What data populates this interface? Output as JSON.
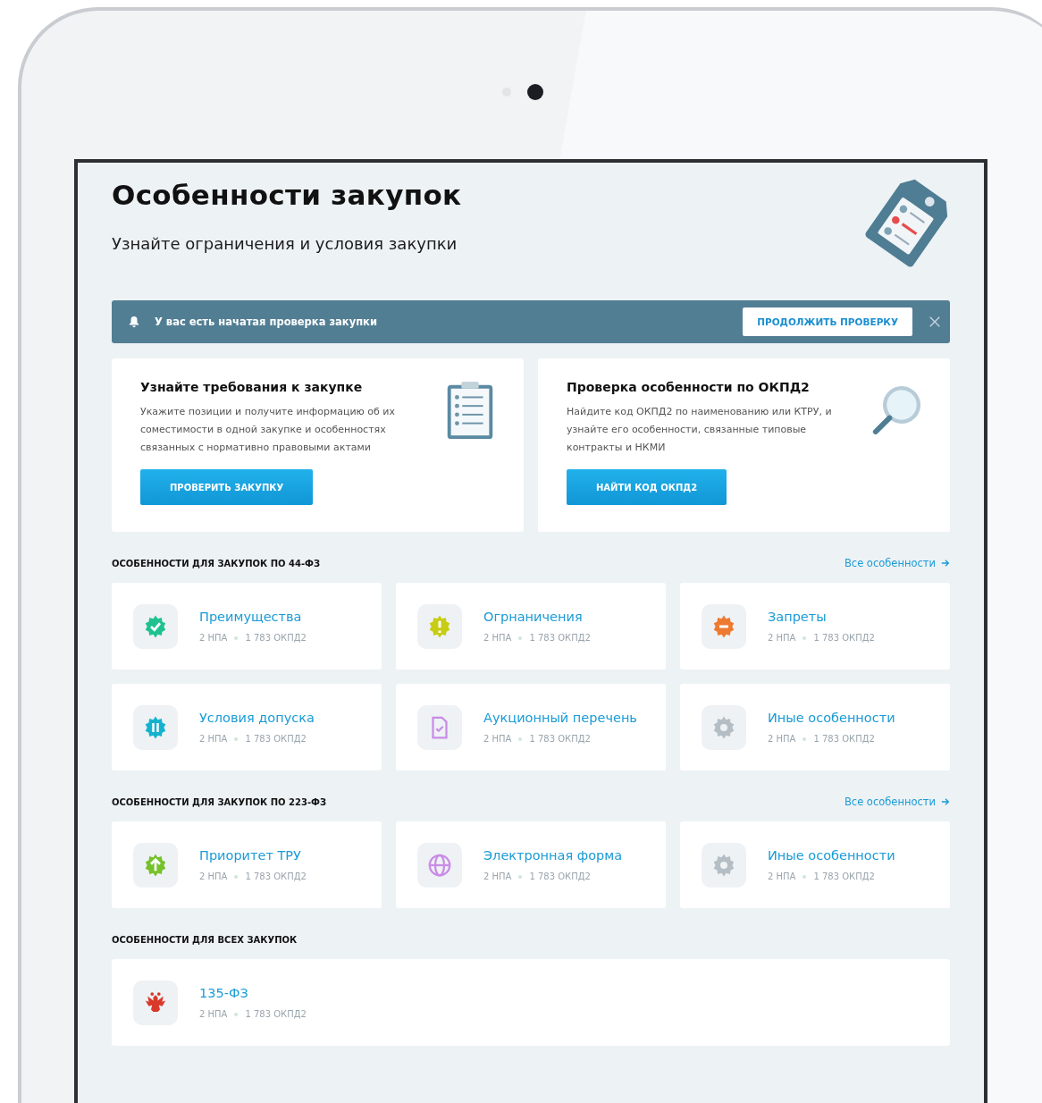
{
  "header": {
    "title": "Особенности закупок",
    "subtitle": "Узнайте ограничения и условия закупки"
  },
  "notice": {
    "text": "У вас есть начатая проверка закупки",
    "button": "ПРОДОЛЖИТЬ ПРОВЕРКУ"
  },
  "promo_cards": [
    {
      "kind": "clipboard",
      "title": "Узнайте требования к закупке",
      "text": "Укажите позиции и получите информацию об их соместимости в одной закупке и особенностях связанных с нормативно правовыми актами",
      "button": "ПРОВЕРИТЬ ЗАКУПКУ"
    },
    {
      "kind": "magnifier",
      "title": "Проверка особенности по ОКПД2",
      "text": "Найдите код ОКПД2 по наименованию или КТРУ, и узнайте его особенности, связанные типовые контракты и НКМИ",
      "button": "НАЙТИ КОД ОКПД2"
    }
  ],
  "sections": [
    {
      "title": "ОСОБЕННОСТИ ДЛЯ ЗАКУПОК ПО 44-ФЗ",
      "link": "Все особенности",
      "items": [
        {
          "kind": "check",
          "color": "#1fc28e",
          "title": "Преимущества",
          "npa": "2 НПА",
          "okpd": "1 783 ОКПД2"
        },
        {
          "kind": "exclaim",
          "color": "#c8cc12",
          "title": "Огрнаничения",
          "npa": "2 НПА",
          "okpd": "1 783 ОКПД2"
        },
        {
          "kind": "minus",
          "color": "#ee7a32",
          "title": "Запреты",
          "npa": "2 НПА",
          "okpd": "1 783 ОКПД2"
        },
        {
          "kind": "pause",
          "color": "#13b3cf",
          "title": "Условия допуска",
          "npa": "2 НПА",
          "okpd": "1 783 ОКПД2"
        },
        {
          "kind": "document",
          "color": "#c98ce6",
          "title": "Аукционный перечень",
          "npa": "2 НПА",
          "okpd": "1 783 ОКПД2"
        },
        {
          "kind": "gear",
          "color": "#b5bec5",
          "title": "Иные особенности",
          "npa": "2 НПА",
          "okpd": "1 783 ОКПД2"
        }
      ]
    },
    {
      "title": "ОСОБЕННОСТИ ДЛЯ ЗАКУПОК ПО 223-ФЗ",
      "link": "Все особенности",
      "items": [
        {
          "kind": "up",
          "color": "#75c22b",
          "title": "Приоритет ТРУ",
          "npa": "2 НПА",
          "okpd": "1 783 ОКПД2"
        },
        {
          "kind": "globe",
          "color": "#c98ce6",
          "title": "Электронная форма",
          "npa": "2 НПА",
          "okpd": "1 783 ОКПД2"
        },
        {
          "kind": "gear",
          "color": "#b5bec5",
          "title": "Иные особенности",
          "npa": "2 НПА",
          "okpd": "1 783 ОКПД2"
        }
      ]
    },
    {
      "title": "ОСОБЕННОСТИ ДЛЯ ВСЕХ ЗАКУПОК",
      "items": [
        {
          "kind": "eagle",
          "color": "#d8392b",
          "title": "135-ФЗ",
          "npa": "2 НПА",
          "okpd": "1 783 ОКПД2"
        }
      ]
    }
  ]
}
